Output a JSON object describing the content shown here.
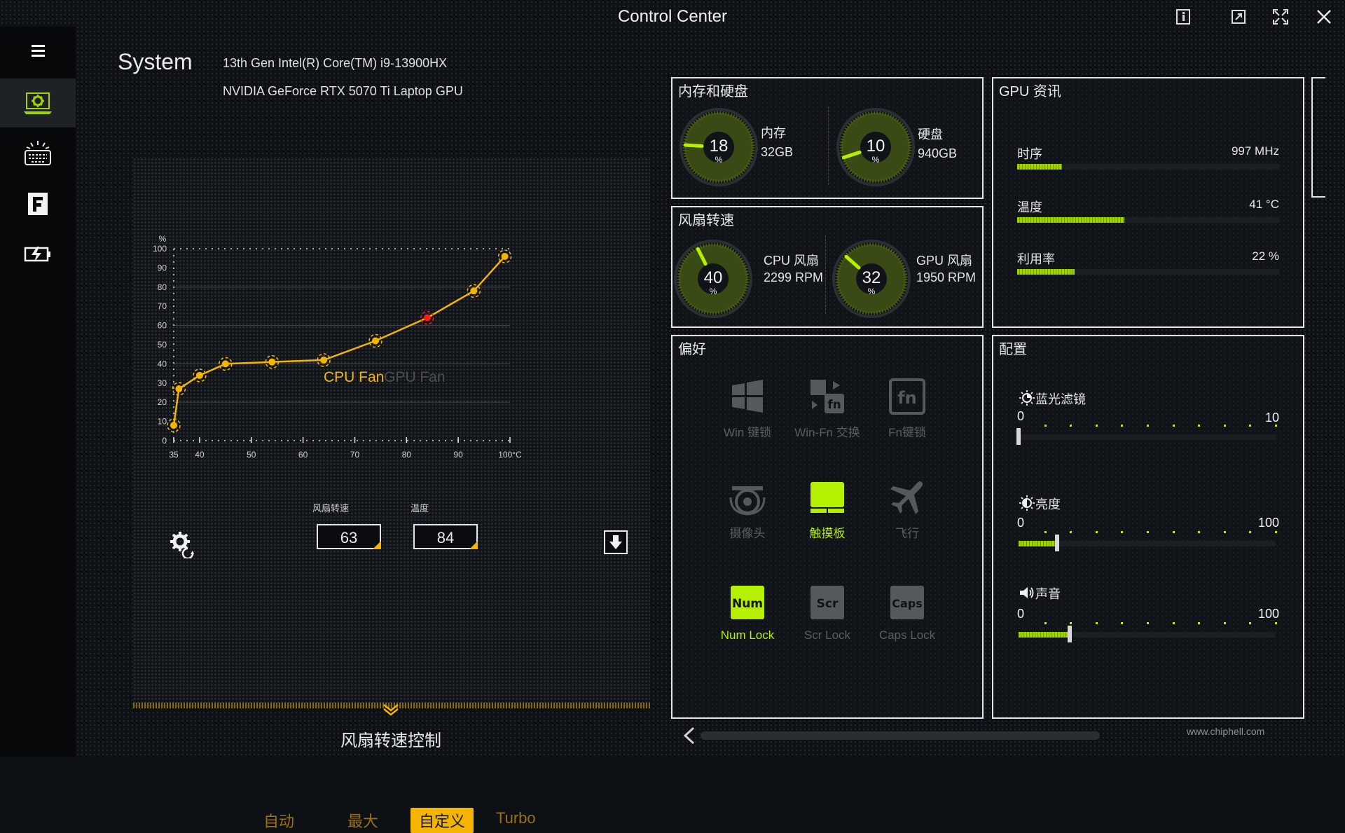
{
  "window": {
    "title": "Control Center",
    "buttons": [
      "info-icon",
      "restore-icon",
      "fullscreen-icon",
      "close-icon"
    ]
  },
  "sidebar": {
    "items": [
      "menu-icon",
      "system-icon",
      "keyboard-light-icon",
      "f-key-icon",
      "battery-icon"
    ],
    "active_index": 1,
    "accent": "#9fd400"
  },
  "system": {
    "title": "System",
    "cpu": "13th Gen Intel(R) Core(TM) i9-13900HX",
    "gpu": "NVIDIA GeForce RTX 5070 Ti Laptop GPU"
  },
  "fan_control": {
    "tabs": [
      "CPU Fan",
      "GPU Fan"
    ],
    "active_tab": "CPU Fan",
    "speed_label": "风扇转速",
    "speed_value": "63",
    "temp_label": "温度",
    "temp_value": "84",
    "modes": [
      "自动",
      "最大",
      "自定义",
      "Turbo"
    ],
    "active_mode": "自定义",
    "footer": "风扇转速控制",
    "accent": "#f5b400",
    "selected_color": "#ff1a1a"
  },
  "chart_data": {
    "type": "line",
    "series": [
      {
        "x": [
          35,
          36,
          40,
          45,
          54,
          64,
          74,
          84,
          93,
          99
        ],
        "y": [
          8,
          27,
          34,
          40,
          41,
          42,
          52,
          64,
          78,
          96
        ]
      }
    ],
    "selected_point_index": 7,
    "xlim": [
      35,
      100
    ],
    "ylim": [
      0,
      100
    ],
    "x_ticks": [
      "35",
      "40",
      "50",
      "60",
      "70",
      "80",
      "90",
      "100°C"
    ],
    "y_ticks": [
      "0",
      "10",
      "20",
      "30",
      "40",
      "50",
      "60",
      "70",
      "80",
      "90",
      "100"
    ],
    "y_unit": "%",
    "gridlines_y": [
      20,
      40,
      60,
      80
    ]
  },
  "memory_disk": {
    "title": "内存和硬盘",
    "memory": {
      "percent": "18",
      "unit": "%",
      "label": "内存",
      "size": "32GB",
      "value": 18
    },
    "disk": {
      "percent": "10",
      "unit": "%",
      "label": "硬盘",
      "size": "940GB",
      "value": 10
    }
  },
  "fan_speed": {
    "title": "风扇转速",
    "cpu": {
      "percent": "40",
      "unit": "%",
      "label": "CPU 风扇",
      "rpm": "2299 RPM",
      "value": 40
    },
    "gpu": {
      "percent": "32",
      "unit": "%",
      "label": "GPU 风扇",
      "rpm": "1950 RPM",
      "value": 32
    }
  },
  "gpu_info": {
    "title": "GPU 资讯",
    "rows": [
      {
        "label": "时序",
        "value": "997 MHz",
        "fill": 0.17
      },
      {
        "label": "温度",
        "value": "41 °C",
        "fill": 0.41
      },
      {
        "label": "利用率",
        "value": "22 %",
        "fill": 0.22
      }
    ]
  },
  "preferences": {
    "title": "偏好",
    "items": [
      {
        "label": "Win 键锁",
        "on": false
      },
      {
        "label": "Win-Fn 交换",
        "on": false
      },
      {
        "label": "Fn键锁",
        "on": false
      },
      {
        "label": "摄像头",
        "on": false
      },
      {
        "label": "触摸板",
        "on": true
      },
      {
        "label": "飞行",
        "on": false
      },
      {
        "label": "Num Lock",
        "on": true,
        "key": "Num"
      },
      {
        "label": "Scr Lock",
        "on": false,
        "key": "Scr"
      },
      {
        "label": "Caps Lock",
        "on": false,
        "key": "Caps"
      }
    ]
  },
  "config": {
    "title": "配置",
    "sliders": [
      {
        "label": "蓝光滤镜",
        "min": "0",
        "max": "10",
        "value": 0
      },
      {
        "label": "亮度",
        "min": "0",
        "max": "100",
        "value": 15
      },
      {
        "label": "声音",
        "min": "0",
        "max": "100",
        "value": 20
      }
    ]
  },
  "watermark": "www.chiphell.com"
}
